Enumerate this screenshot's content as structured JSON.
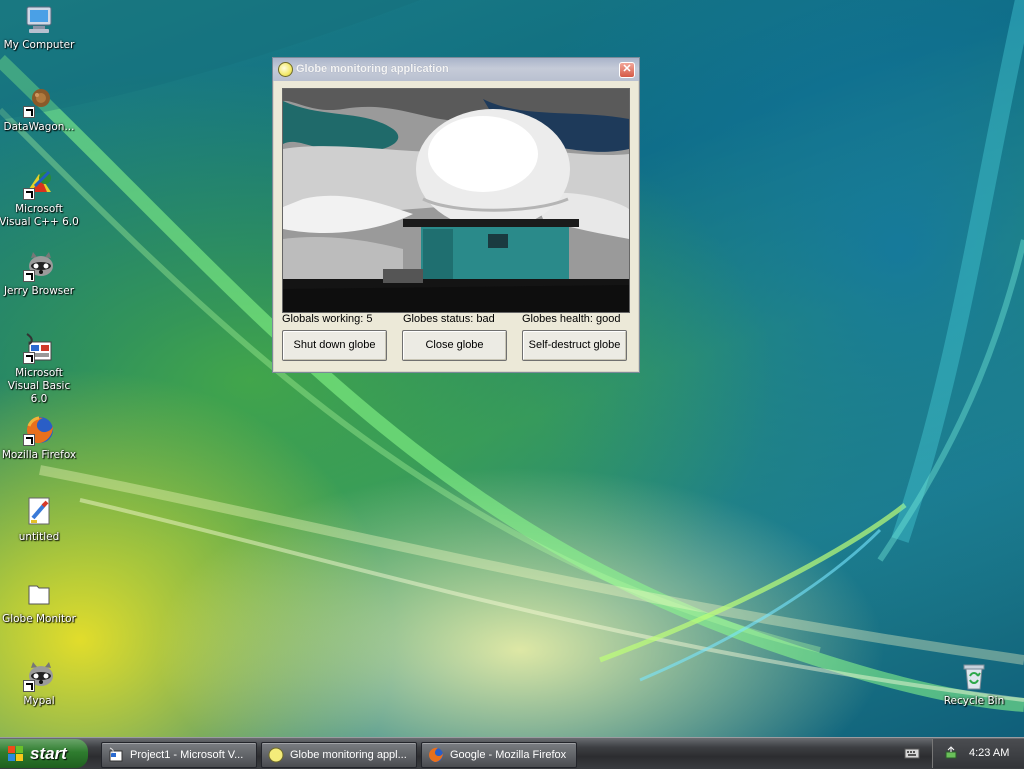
{
  "desktop": {
    "icons": [
      {
        "label": "My Computer"
      },
      {
        "label": "DataWagon..."
      },
      {
        "label": "Microsoft Visual C++ 6.0"
      },
      {
        "label": "Jerry Browser"
      },
      {
        "label": "Microsoft Visual Basic 6.0"
      },
      {
        "label": "Mozilla Firefox"
      },
      {
        "label": "untitled"
      },
      {
        "label": "Globe Monitor"
      },
      {
        "label": "Mypal"
      },
      {
        "label": "Recycle Bin"
      }
    ]
  },
  "window": {
    "title": "Globe monitoring application",
    "close_glyph": "✕",
    "status": {
      "working": "Globals working: 5",
      "state": "Globes status:  bad",
      "health": "Globes health: good"
    },
    "buttons": {
      "shutdown": "Shut down globe",
      "close": "Close globe",
      "selfdestruct": "Self-destruct globe"
    }
  },
  "taskbar": {
    "start_label": "start",
    "tasks": [
      {
        "label": "Project1 - Microsoft V...",
        "icon": "vb-project-icon"
      },
      {
        "label": "Globe monitoring appl...",
        "icon": "globe-app-icon"
      },
      {
        "label": "Google - Mozilla Firefox",
        "icon": "firefox-icon"
      }
    ],
    "clock": "4:23 AM"
  }
}
